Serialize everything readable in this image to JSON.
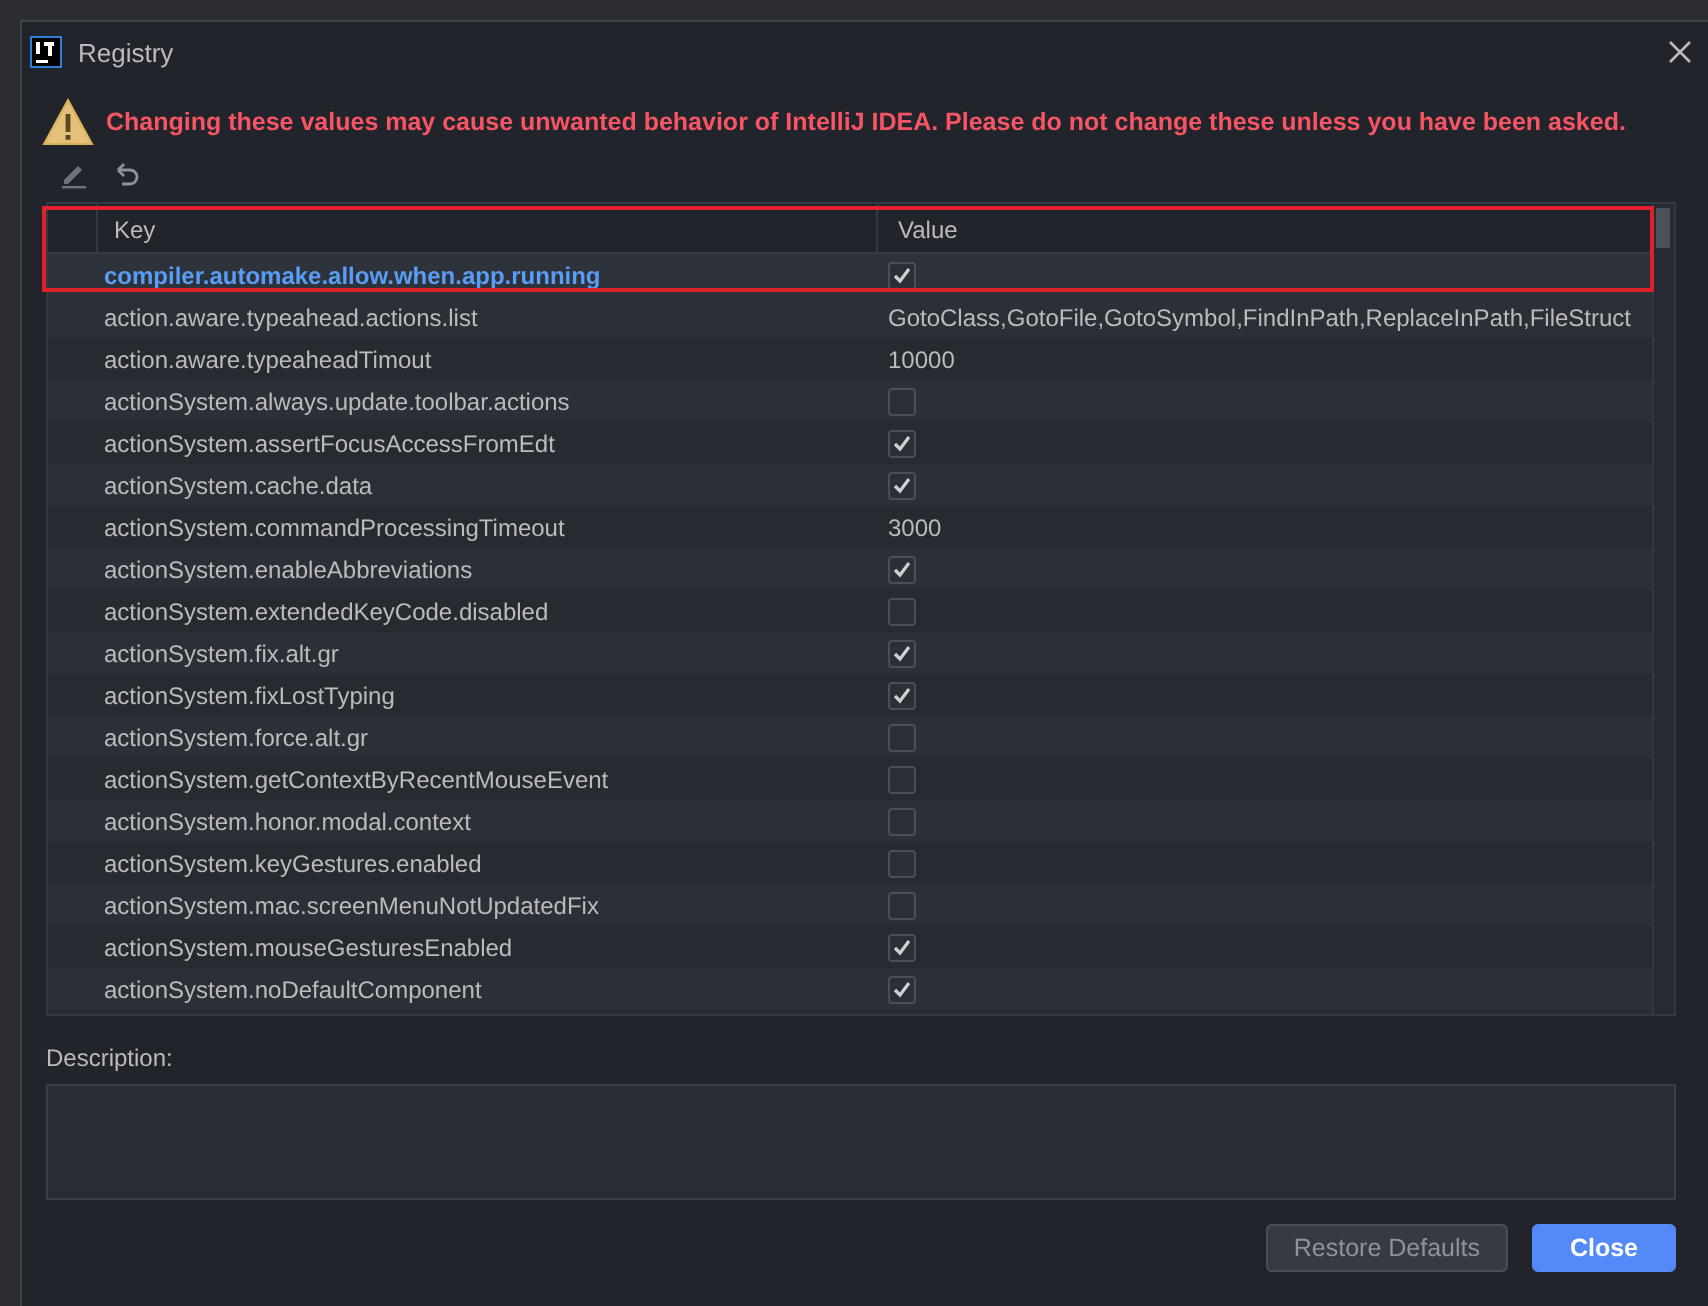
{
  "window": {
    "title": "Registry"
  },
  "warning": "Changing these values may cause unwanted behavior of IntelliJ IDEA. Please do not change these unless you have been asked.",
  "table": {
    "columns": [
      "Key",
      "Value"
    ],
    "rows": [
      {
        "key": "compiler.automake.allow.when.app.running",
        "kind": "checkbox",
        "checked": true,
        "selected": true
      },
      {
        "key": "action.aware.typeahead.actions.list",
        "kind": "text",
        "value": "GotoClass,GotoFile,GotoSymbol,FindInPath,ReplaceInPath,FileStruct",
        "selected": false
      },
      {
        "key": "action.aware.typeaheadTimout",
        "kind": "text",
        "value": "10000",
        "selected": false
      },
      {
        "key": "actionSystem.always.update.toolbar.actions",
        "kind": "checkbox",
        "checked": false,
        "selected": false
      },
      {
        "key": "actionSystem.assertFocusAccessFromEdt",
        "kind": "checkbox",
        "checked": true,
        "selected": false
      },
      {
        "key": "actionSystem.cache.data",
        "kind": "checkbox",
        "checked": true,
        "selected": false
      },
      {
        "key": "actionSystem.commandProcessingTimeout",
        "kind": "text",
        "value": "3000",
        "selected": false
      },
      {
        "key": "actionSystem.enableAbbreviations",
        "kind": "checkbox",
        "checked": true,
        "selected": false
      },
      {
        "key": "actionSystem.extendedKeyCode.disabled",
        "kind": "checkbox",
        "checked": false,
        "selected": false
      },
      {
        "key": "actionSystem.fix.alt.gr",
        "kind": "checkbox",
        "checked": true,
        "selected": false
      },
      {
        "key": "actionSystem.fixLostTyping",
        "kind": "checkbox",
        "checked": true,
        "selected": false
      },
      {
        "key": "actionSystem.force.alt.gr",
        "kind": "checkbox",
        "checked": false,
        "selected": false
      },
      {
        "key": "actionSystem.getContextByRecentMouseEvent",
        "kind": "checkbox",
        "checked": false,
        "selected": false
      },
      {
        "key": "actionSystem.honor.modal.context",
        "kind": "checkbox",
        "checked": false,
        "selected": false
      },
      {
        "key": "actionSystem.keyGestures.enabled",
        "kind": "checkbox",
        "checked": false,
        "selected": false
      },
      {
        "key": "actionSystem.mac.screenMenuNotUpdatedFix",
        "kind": "checkbox",
        "checked": false,
        "selected": false
      },
      {
        "key": "actionSystem.mouseGesturesEnabled",
        "kind": "checkbox",
        "checked": true,
        "selected": false
      },
      {
        "key": "actionSystem.noDefaultComponent",
        "kind": "checkbox",
        "checked": true,
        "selected": false
      }
    ]
  },
  "description": {
    "label": "Description:"
  },
  "buttons": [
    {
      "label": "Restore Defaults",
      "kind": "secondary"
    },
    {
      "label": "Close",
      "kind": "primary"
    }
  ]
}
